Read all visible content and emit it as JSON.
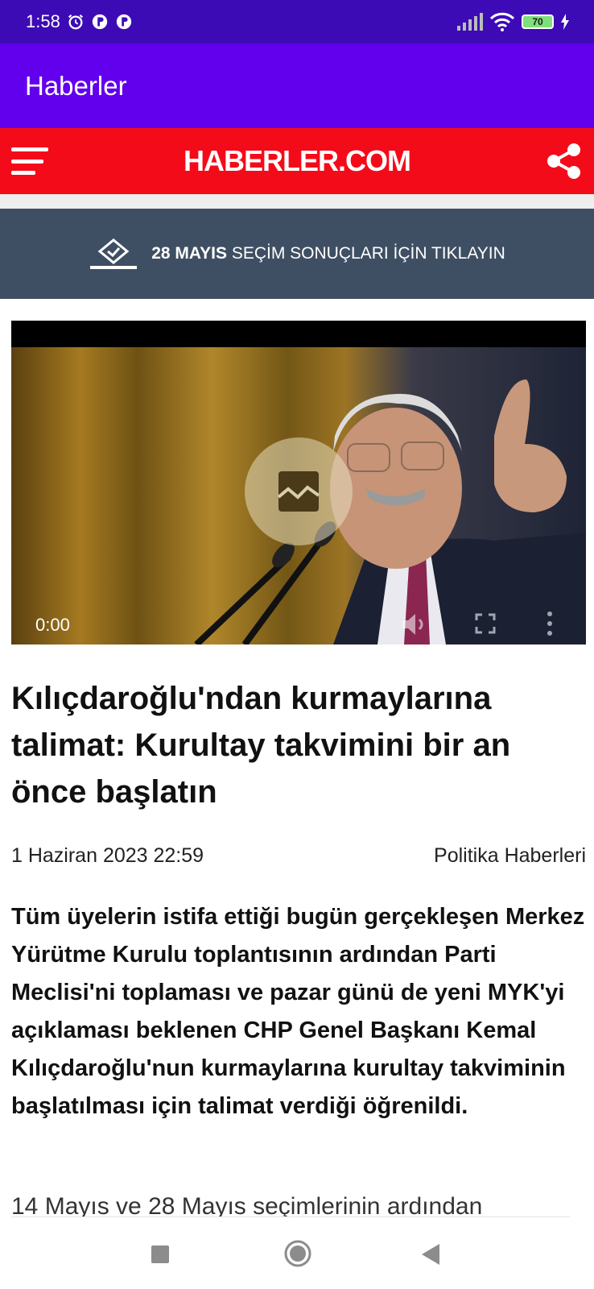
{
  "status_bar": {
    "time": "1:58",
    "battery": "70",
    "icons": [
      "alarm-icon",
      "app-notification-icon",
      "app-notification-icon",
      "signal-icon",
      "wifi-icon",
      "battery-icon",
      "charging-icon"
    ]
  },
  "app_bar": {
    "title": "Haberler"
  },
  "site_header": {
    "logo": "HABERLER.COM",
    "icons": [
      "hamburger-menu-icon",
      "share-icon"
    ]
  },
  "election_banner": {
    "date": "28 MAYIS",
    "text": "SEÇİM SONUÇLARI İÇİN TIKLAYIN",
    "icon": "ballot-box-icon"
  },
  "video": {
    "time": "0:00",
    "icons": [
      "image-placeholder-icon",
      "mute-icon",
      "fullscreen-icon",
      "more-vert-icon"
    ]
  },
  "article": {
    "headline": "Kılıçdaroğlu'ndan kurmaylarına talimat: Kurultay takvimini bir an önce başlatın",
    "date": "1 Haziran 2023 22:59",
    "category": "Politika Haberleri",
    "lead": "Tüm üyelerin istifa ettiği bugün gerçekleşen Merkez Yürütme Kurulu toplantısının ardından Parti Meclisi'ni toplaması ve pazar günü de yeni MYK'yi açıklaması beklenen CHP Genel Başkanı Kemal Kılıçdaroğlu'nun kurmaylarına kurultay takviminin başlatılması için talimat verdiği öğrenildi.",
    "body_start": "14 Mayıs ve 28 Mayıs seçimlerinin ardından"
  },
  "nav_bar": {
    "icons": [
      "recent-apps-icon",
      "home-icon",
      "back-icon"
    ]
  },
  "colors": {
    "status_bar": "#3d0bb5",
    "app_bar": "#6200ee",
    "site_header": "#f40b1a",
    "banner": "#3f4f63"
  }
}
